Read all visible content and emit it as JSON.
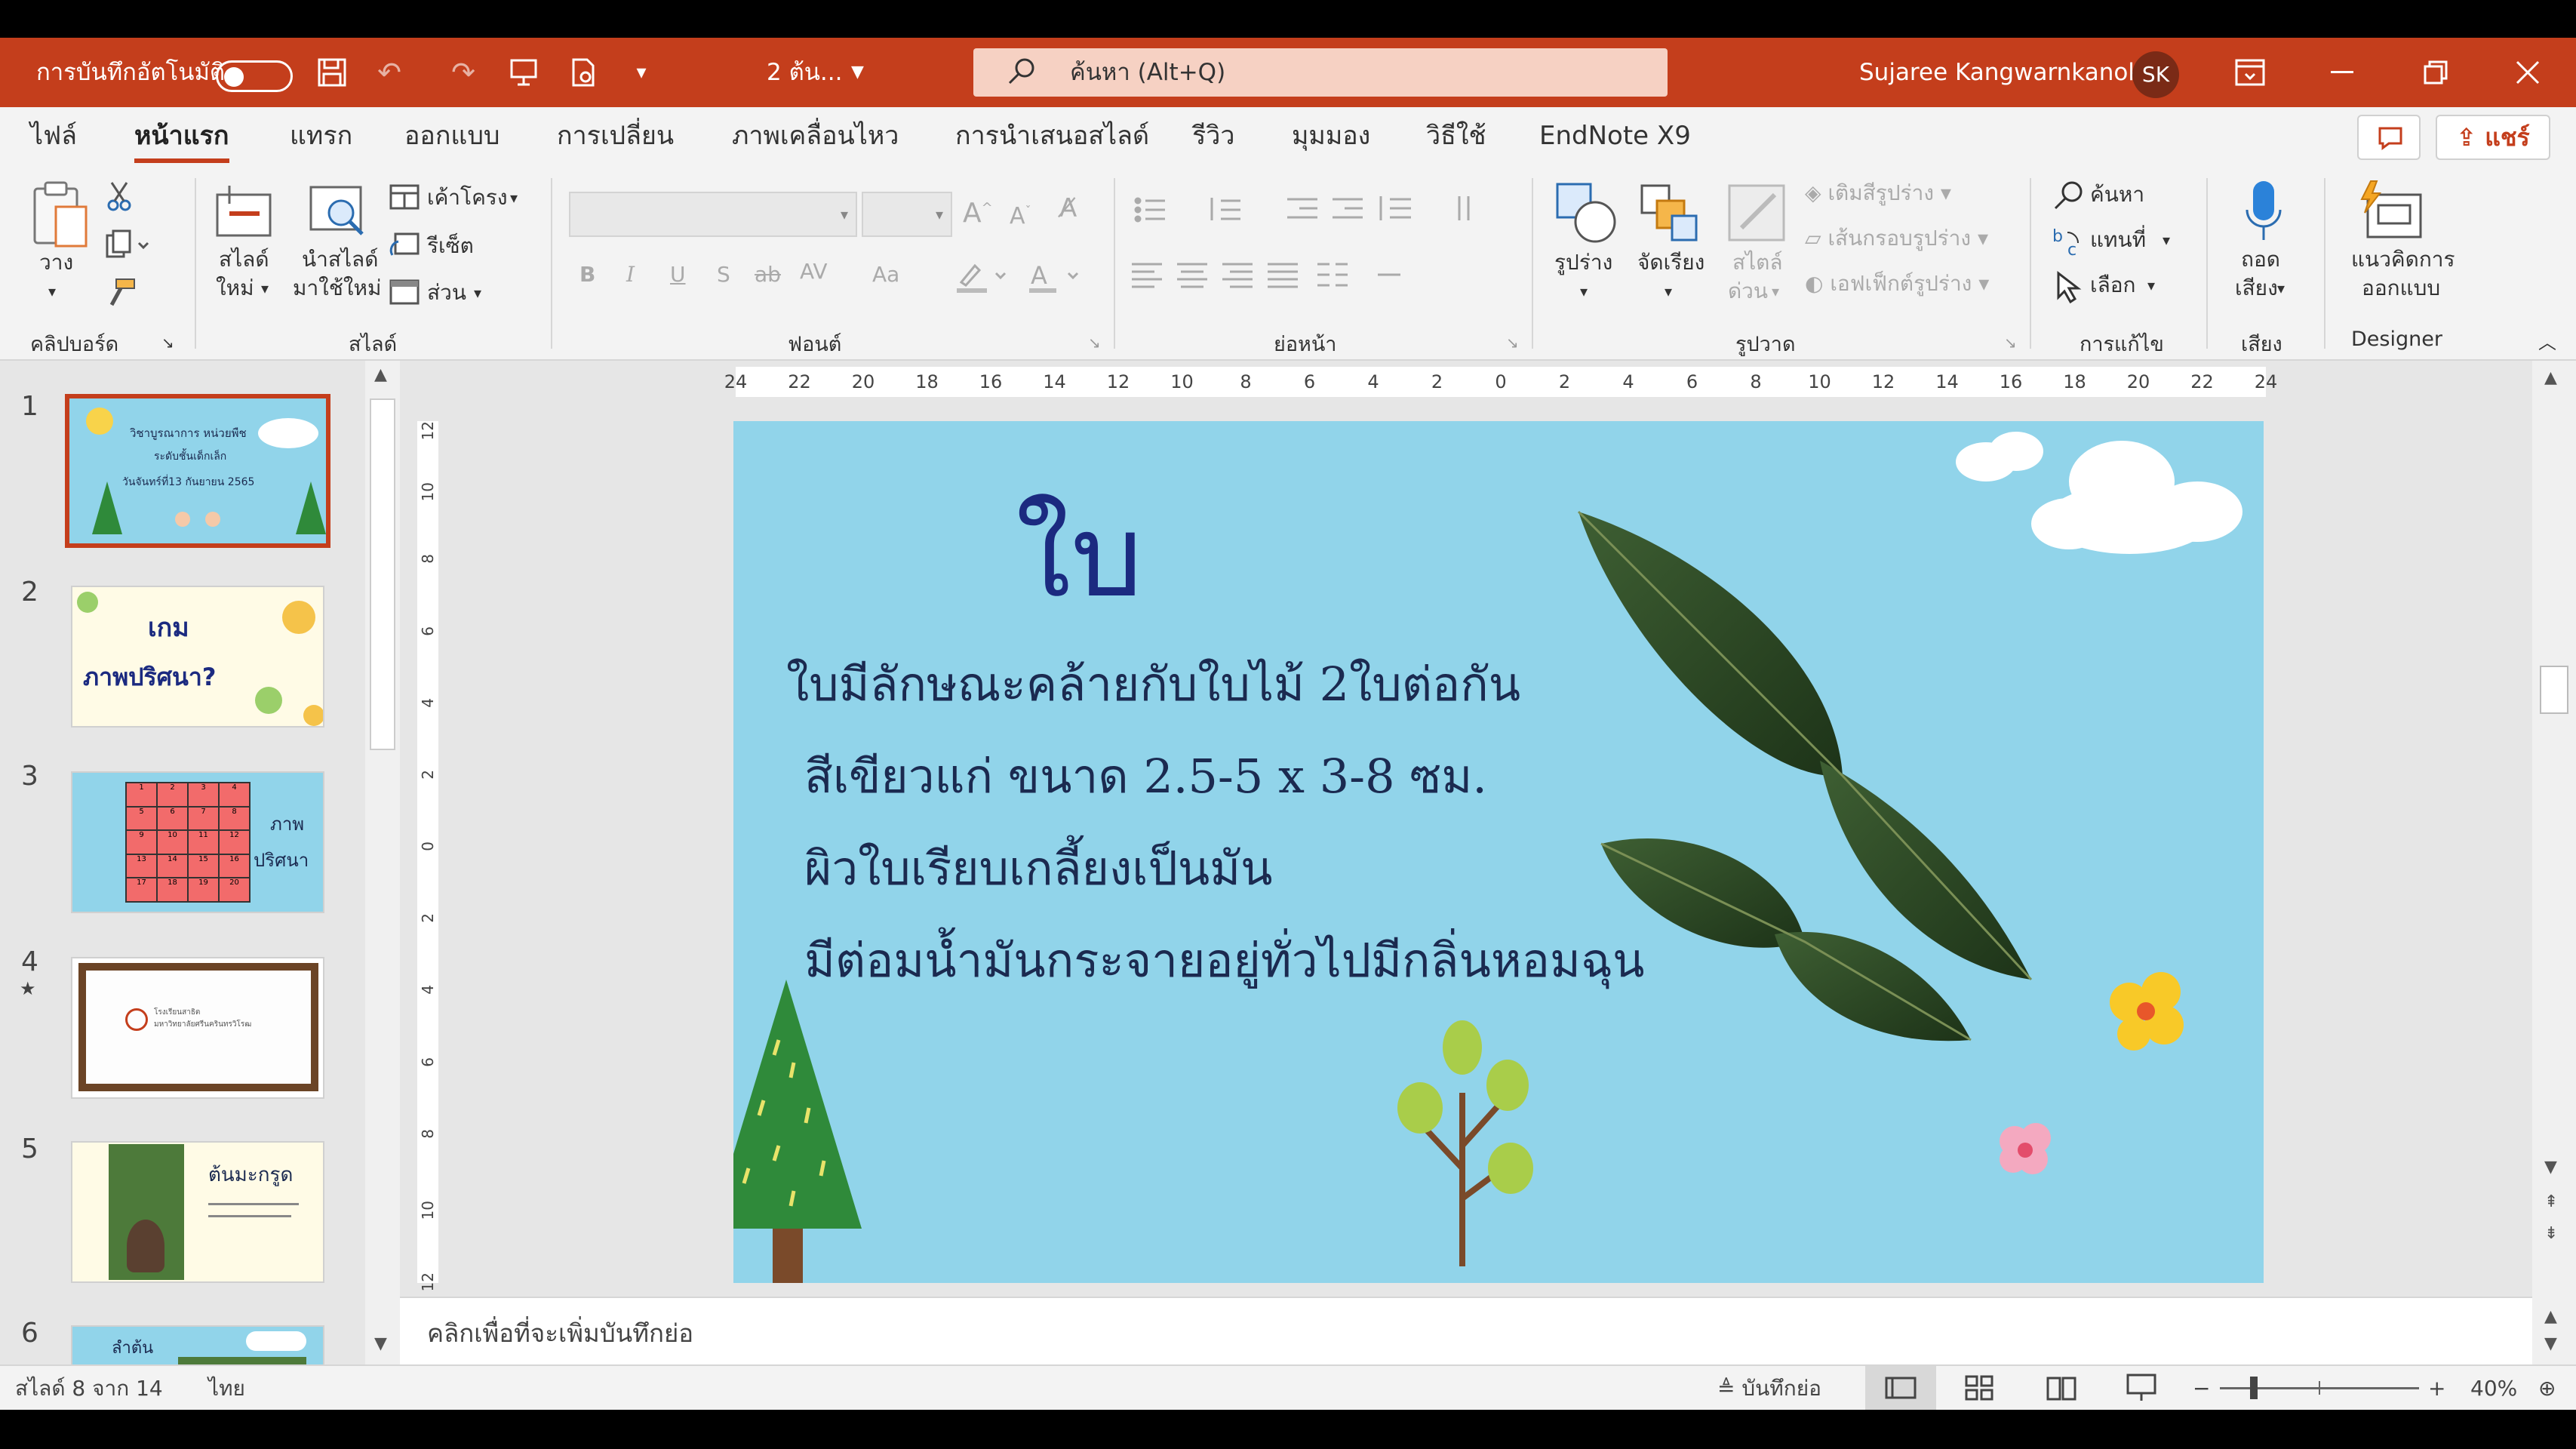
{
  "titlebar": {
    "autosave_label": "การบันทึกอัตโนมัติ",
    "doc_title": "2 ต้น...",
    "search_placeholder": "ค้นหา (Alt+Q)",
    "user_name": "Sujaree Kangwarnkanok",
    "user_initials": "SK"
  },
  "tabs": [
    "ไฟล์",
    "หน้าแรก",
    "แทรก",
    "ออกแบบ",
    "การเปลี่ยน",
    "ภาพเคลื่อนไหว",
    "การนำเสนอสไลด์",
    "รีวิว",
    "มุมมอง",
    "วิธีใช้",
    "EndNote X9"
  ],
  "active_tab": "หน้าแรก",
  "share_label": "แชร์",
  "ribbon": {
    "clipboard": {
      "paste": "วาง",
      "group": "คลิปบอร์ด"
    },
    "slides": {
      "new_slide": [
        "สไลด์",
        "ใหม่"
      ],
      "reuse": [
        "นำสไลด์",
        "มาใช้ใหม่"
      ],
      "layout": "เค้าโครง",
      "reset": "รีเซ็ต",
      "section": "ส่วน",
      "group": "สไลด์"
    },
    "font": {
      "bold": "B",
      "italic": "I",
      "underline": "U",
      "shadow": "S",
      "strike": "ab",
      "spacing": "AV",
      "case": "Aa",
      "group": "ฟอนต์"
    },
    "paragraph": {
      "group": "ย่อหน้า"
    },
    "drawing": {
      "shapes": "รูปร่าง",
      "arrange": "จัดเรียง",
      "styles": [
        "สไตล์",
        "ด่วน"
      ],
      "fill": "เติมสีรูปร่าง",
      "outline": "เส้นกรอบรูปร่าง",
      "effects": "เอฟเฟ็กต์รูปร่าง",
      "group": "รูปวาด"
    },
    "editing": {
      "find": "ค้นหา",
      "replace": "แทนที่",
      "select": "เลือก",
      "group": "การแก้ไข"
    },
    "voice": {
      "dictate": [
        "ถอด",
        "เสียง"
      ],
      "group": "เสียง"
    },
    "designer": {
      "ideas": [
        "แนวคิดการ",
        "ออกแบบ"
      ],
      "group": "Designer"
    }
  },
  "thumbnails": [
    {
      "num": "1",
      "lines": [
        "วิชาบูรณาการ หน่วยพืช",
        "ระดับชั้นเด็กเล็ก",
        "วันจันทร์ที่13 กันยายน 2565"
      ]
    },
    {
      "num": "2",
      "lines": [
        "เกม",
        "ภาพปริศนา?"
      ]
    },
    {
      "num": "3",
      "lines": [
        "ภาพ",
        "ปริศนา"
      ],
      "grid": [
        "1",
        "2",
        "3",
        "4",
        "5",
        "6",
        "7",
        "8",
        "9",
        "10",
        "11",
        "12",
        "13",
        "14",
        "15",
        "16",
        "17",
        "18",
        "19",
        "20"
      ]
    },
    {
      "num": "4",
      "lines": [
        "โรงเรียนสาธิต",
        "มหาวิทยาลัยศรีนครินทรวิโรฒ"
      ]
    },
    {
      "num": "5",
      "lines": [
        "ต้นมะกรูด"
      ]
    },
    {
      "num": "6",
      "lines": [
        "ลำต้น"
      ]
    }
  ],
  "ruler": {
    "h_ticks": [
      "24",
      "22",
      "20",
      "18",
      "16",
      "14",
      "12",
      "10",
      "8",
      "6",
      "4",
      "2",
      "0",
      "2",
      "4",
      "6",
      "8",
      "10",
      "12",
      "14",
      "16",
      "18",
      "20",
      "22",
      "24"
    ],
    "v_ticks": [
      "12",
      "10",
      "8",
      "6",
      "4",
      "2",
      "0",
      "2",
      "4",
      "6",
      "8",
      "10",
      "12"
    ]
  },
  "slide": {
    "title": "ใบ",
    "lines": [
      "ใบมีลักษณะคล้ายกับใบไม้ 2ใบต่อกัน",
      "สีเขียวแก่ ขนาด 2.5-5 x 3-8 ซม.",
      "ผิวใบเรียบเกลี้ยงเป็นมัน",
      "มีต่อมน้ำมันกระจายอยู่ทั่วไปมีกลิ่นหอมฉุน"
    ]
  },
  "notes_placeholder": "คลิกเพื่อที่จะเพิ่มบันทึกย่อ",
  "status": {
    "slide_info": "สไลด์ 8 จาก 14",
    "language": "ไทย",
    "notes": "บันทึกย่อ",
    "zoom": "40%"
  },
  "colors": {
    "accent": "#c43e1c",
    "slide_bg": "#91d4ea",
    "leaf": "#2e4a26"
  }
}
